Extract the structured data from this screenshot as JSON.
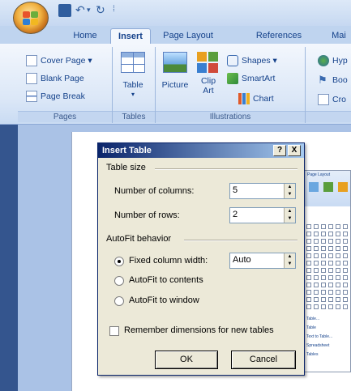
{
  "tabs": [
    {
      "label": "Home"
    },
    {
      "label": "Insert"
    },
    {
      "label": "Page Layout"
    },
    {
      "label": "References"
    },
    {
      "label": "Mai"
    }
  ],
  "ribbon": {
    "pages": {
      "items": [
        "Cover Page ▾",
        "Blank Page",
        "Page Break"
      ],
      "label": "Pages"
    },
    "tables": {
      "table": "Table",
      "label": "Tables"
    },
    "illustrations": {
      "picture": "Picture",
      "clip_art": "Clip Art",
      "shapes": "Shapes ▾",
      "smartart": "SmartArt",
      "chart": "Chart",
      "label": "Illustrations"
    },
    "links": {
      "items": [
        "Hyp",
        "Boo",
        "Cro"
      ]
    }
  },
  "dialog": {
    "title": "Insert Table",
    "help": "?",
    "close": "X",
    "table_size": "Table size",
    "columns_label": "Number of columns:",
    "columns_value": "5",
    "rows_label": "Number of rows:",
    "rows_value": "2",
    "autofit": "AutoFit behavior",
    "fixed_label": "Fixed column width:",
    "fixed_value": "Auto",
    "fit_contents": "AutoFit to contents",
    "fit_window": "AutoFit to window",
    "remember": "Remember dimensions for new tables",
    "ok": "OK",
    "cancel": "Cancel"
  },
  "inset": {
    "tab": "Page Layout",
    "menu": [
      "Table...",
      "Table",
      "Text to Table...",
      "Spreadsheet",
      "Tables"
    ]
  },
  "colors": {
    "accent": "#15428b",
    "title_bar": "#0a246a",
    "dialog_bg": "#ece9d8"
  }
}
